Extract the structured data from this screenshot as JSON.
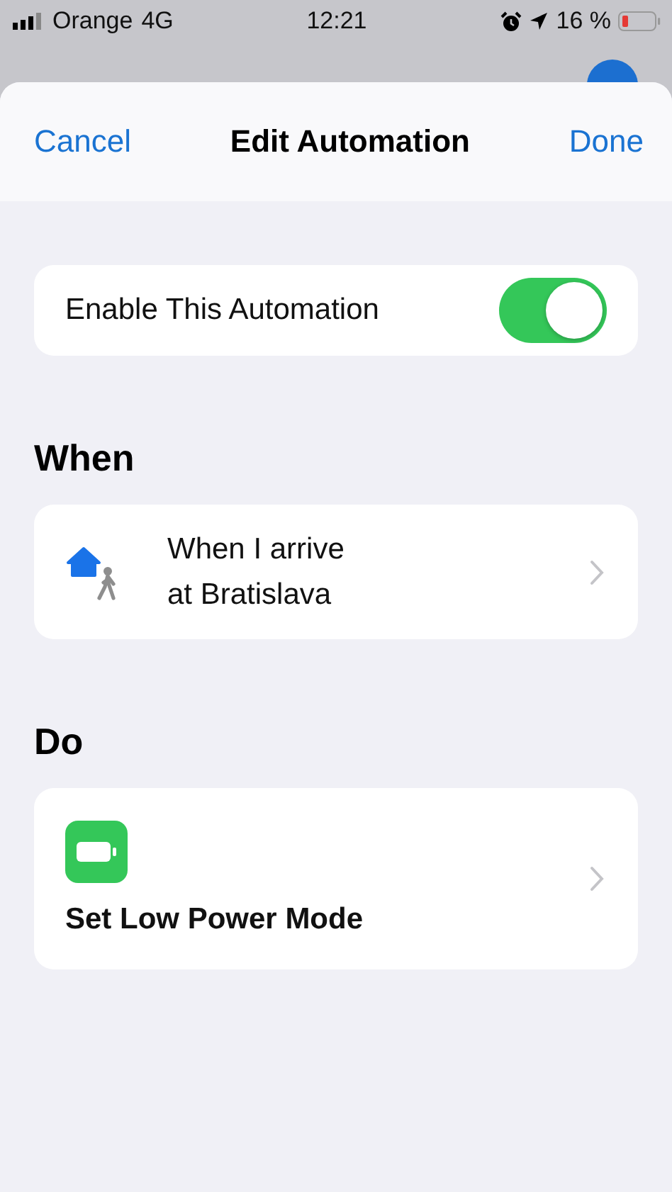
{
  "status_bar": {
    "carrier": "Orange",
    "network": "4G",
    "time": "12:21",
    "battery": "16 %"
  },
  "nav": {
    "cancel": "Cancel",
    "title": "Edit Automation",
    "done": "Done"
  },
  "enable": {
    "label": "Enable This Automation",
    "on": true
  },
  "sections": [
    {
      "heading": "When",
      "card": {
        "kind": "trigger",
        "lines": [
          "When I arrive",
          "at Bratislava"
        ]
      }
    },
    {
      "heading": "Do",
      "card": {
        "kind": "action",
        "lines": [
          "Set Low Power Mode"
        ]
      }
    }
  ]
}
